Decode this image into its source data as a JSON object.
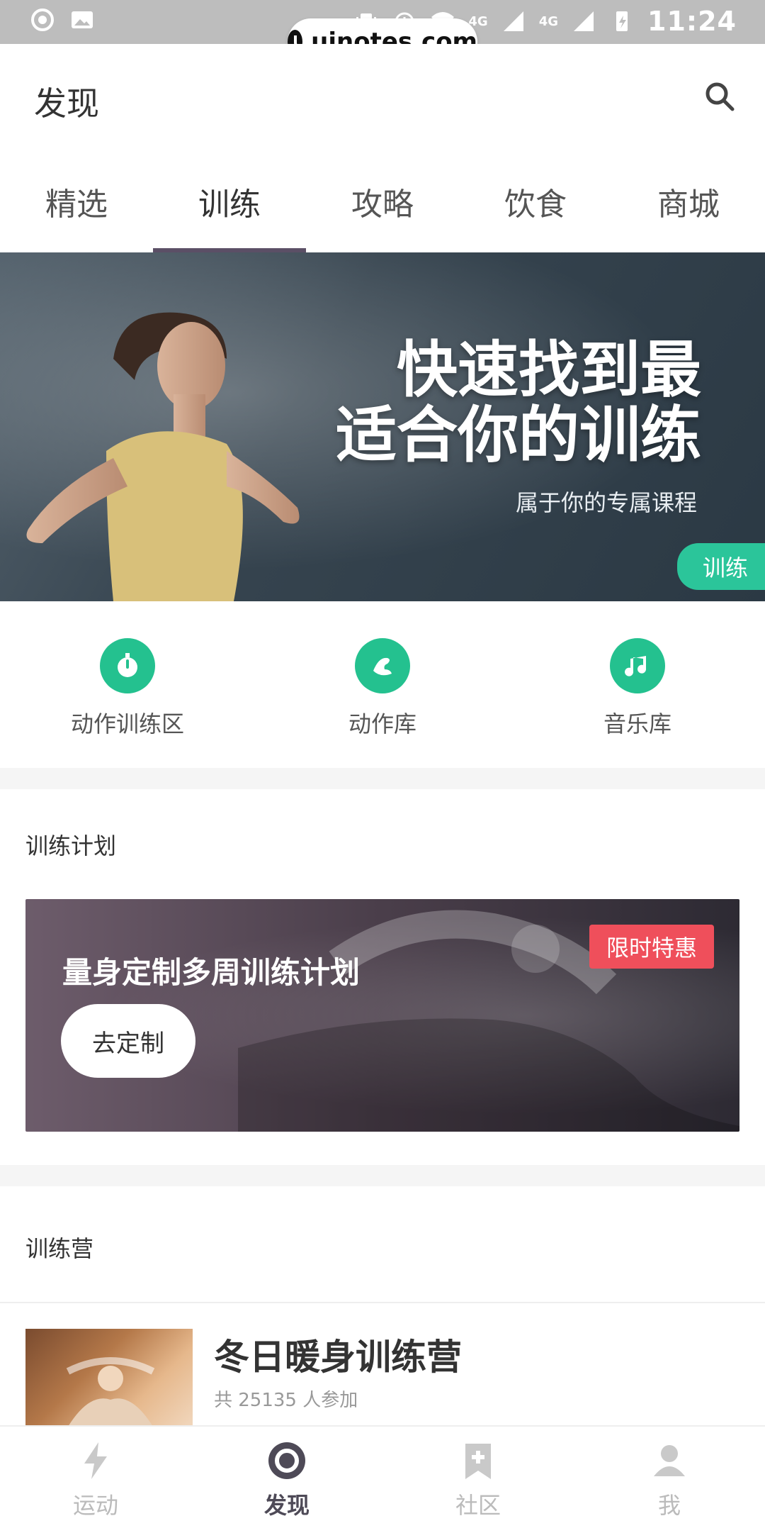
{
  "statusbar": {
    "time": "11:24",
    "network_left": "4G",
    "network_right": "4G"
  },
  "watermark": {
    "text": "uinotes.com"
  },
  "header": {
    "title": "发现"
  },
  "tabs": [
    {
      "label": "精选"
    },
    {
      "label": "训练"
    },
    {
      "label": "攻略"
    },
    {
      "label": "饮食"
    },
    {
      "label": "商城"
    }
  ],
  "hero": {
    "title_line1": "快速找到最",
    "title_line2": "适合你的训练",
    "subtitle": "属于你的专属课程",
    "badge": "训练"
  },
  "quick_actions": [
    {
      "label": "动作训练区",
      "icon": "stopwatch-icon"
    },
    {
      "label": "动作库",
      "icon": "muscle-icon"
    },
    {
      "label": "音乐库",
      "icon": "music-icon"
    }
  ],
  "sections": {
    "plan_title": "训练计划",
    "camp_title": "训练营"
  },
  "plan_card": {
    "title": "量身定制多周训练计划",
    "cta": "去定制",
    "badge": "限时特惠"
  },
  "camp": {
    "title": "冬日暖身训练营",
    "participants": "共 25135 人参加"
  },
  "bottom_nav": [
    {
      "label": "运动",
      "icon": "lightning-icon"
    },
    {
      "label": "发现",
      "icon": "discover-icon"
    },
    {
      "label": "社区",
      "icon": "community-icon"
    },
    {
      "label": "我",
      "icon": "profile-icon"
    }
  ],
  "colors": {
    "accent_green": "#24c18f",
    "badge_red": "#ef4f5b",
    "tab_indicator": "#5b4f66"
  }
}
